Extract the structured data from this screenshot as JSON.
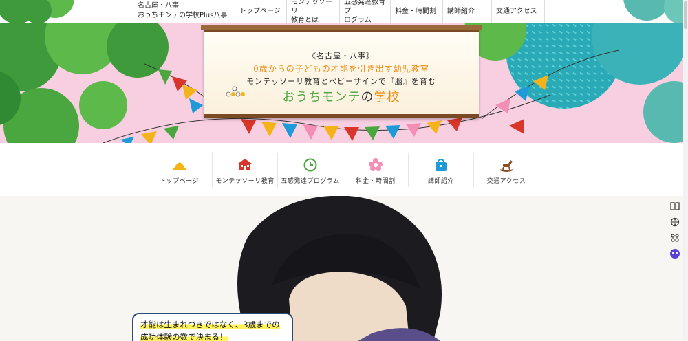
{
  "site": {
    "name_line1": "名古屋・八事",
    "name_line2": "おうちモンテの学校Plus八事"
  },
  "topnav": {
    "items": [
      {
        "label": "トップページ"
      },
      {
        "label": "モンテッソーリ\n教育とは"
      },
      {
        "label": "五感発達教育プ\nログラム"
      },
      {
        "label": "料金・時間割"
      },
      {
        "label": "講師紹介"
      },
      {
        "label": "交通アクセス"
      }
    ]
  },
  "hero": {
    "line1": "《名古屋・八事》",
    "line2": "0歳からの子どもの才能を引き出す幼児教室",
    "line3": "モンテッソーリ教育とベビーサインで『脳』を育む",
    "title_a": "おうちモンテ",
    "title_b": "の",
    "title_c": "学校"
  },
  "iconnav": {
    "items": [
      {
        "label": "トップページ",
        "icon": "hat-icon",
        "color": "#f5b31a"
      },
      {
        "label": "モンテッソーリ教育",
        "icon": "school-icon",
        "color": "#d9362b"
      },
      {
        "label": "五感発達プログラム",
        "icon": "clock-icon",
        "color": "#4aa63e"
      },
      {
        "label": "料金・時間割",
        "icon": "flower-icon",
        "color": "#f38fb6"
      },
      {
        "label": "講師紹介",
        "icon": "bag-icon",
        "color": "#1e9ad6"
      },
      {
        "label": "交通アクセス",
        "icon": "rocking-horse-icon",
        "color": "#8a4b20"
      }
    ]
  },
  "callout": {
    "line1": "才能は生まれつきではなく、3歳までの",
    "line2": "成功体験の数で決まる！"
  },
  "colors": {
    "accent_orange": "#f08c14",
    "accent_green": "#4aa63e",
    "callout_border": "#2c4b7a",
    "highlight": "#fff35a"
  }
}
